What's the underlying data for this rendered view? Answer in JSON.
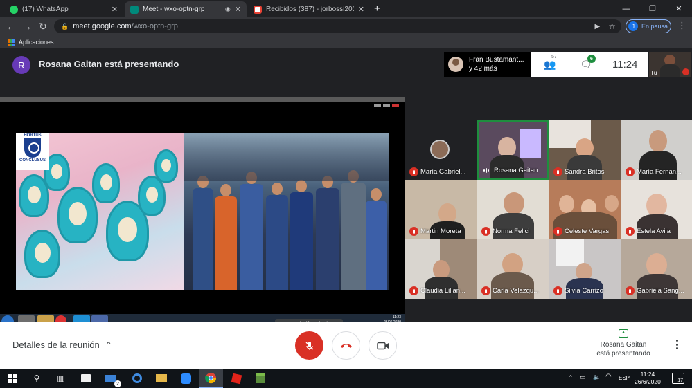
{
  "browser": {
    "tabs": [
      {
        "label": "(17) WhatsApp",
        "active": false,
        "color": "#25d366"
      },
      {
        "label": "Meet - wxo-optn-grp",
        "active": true,
        "color": "#00897b"
      },
      {
        "label": "Recibidos (387) - jorbossi2014@",
        "active": false,
        "color": "#ea4335"
      }
    ],
    "url_host": "meet.google.com",
    "url_path": "/wxo-optn-grp",
    "profile_initial": "J",
    "profile_status": "En pausa",
    "bookmark_apps": "Aplicaciones"
  },
  "meet": {
    "presenter_initial": "R",
    "presenter_title": "Rosana Gaitan está presentando",
    "participants_summary": {
      "line1": "Fran Bustamant...",
      "line2": "y 42 más"
    },
    "people_count": "57",
    "chat_count": "6",
    "clock": "11:24",
    "self_label": "Tú",
    "grid": [
      {
        "name": "María Gabriel...",
        "muted": true
      },
      {
        "name": "Rosana Gaitan",
        "muted": false
      },
      {
        "name": "Sandra Britos",
        "muted": true
      },
      {
        "name": "María Fernan...",
        "muted": true
      },
      {
        "name": "Martin Moreta",
        "muted": true
      },
      {
        "name": "Norma Felici",
        "muted": true
      },
      {
        "name": "Celeste Vargas",
        "muted": true
      },
      {
        "name": "Estela Avila",
        "muted": true
      },
      {
        "name": "Claudia Lilian...",
        "muted": true
      },
      {
        "name": "Carla Velazqu...",
        "muted": true
      },
      {
        "name": "Silvia Carrizo",
        "muted": true
      },
      {
        "name": "Gabriela Sang...",
        "muted": true
      }
    ],
    "slide_logo_top": "HORTUS",
    "slide_logo_bottom": "CONCLUSUS",
    "shared_clock_time": "11:23",
    "shared_clock_date": "26/06/2020",
    "tooltip": "Activar micrófono (Ctrl + D)",
    "details_label": "Detalles de la reunión",
    "presenting_line1": "Rosana Gaitan",
    "presenting_line2": "está presentando"
  },
  "taskbar": {
    "lang": "ESP",
    "time": "11:24",
    "date": "26/6/2020",
    "mail_badge": "2",
    "notifications": "17"
  },
  "colors": {
    "accent": "#1a73e8",
    "danger": "#d93025",
    "meet_bg": "#202124",
    "present_green": "#1e8e3e"
  }
}
